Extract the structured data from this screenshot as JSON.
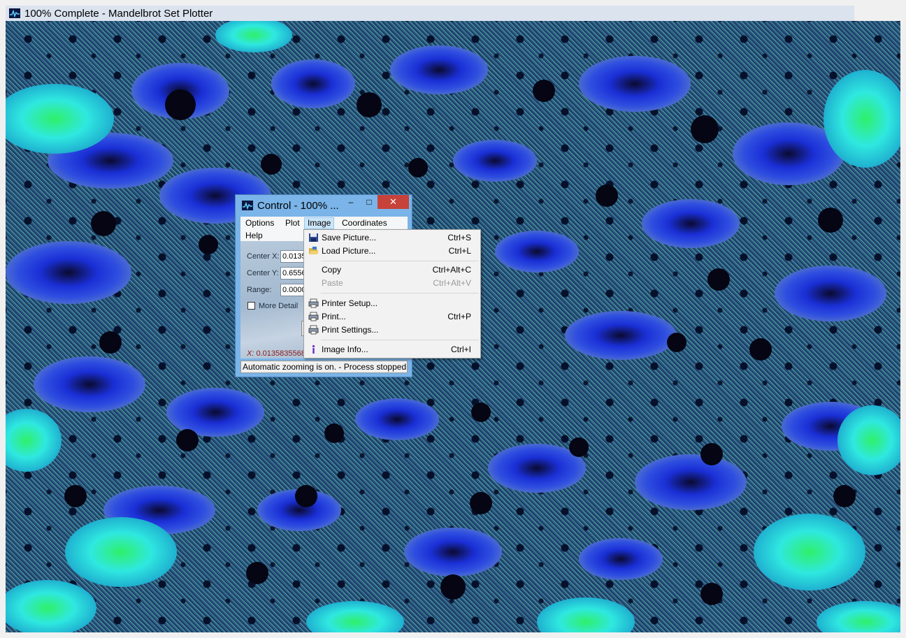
{
  "main_window": {
    "title": "100% Complete - Mandelbrot Set Plotter",
    "icon": "mandelbrot-app-icon"
  },
  "control_window": {
    "title": "Control - 100% ...",
    "caption_buttons": {
      "minimize": "–",
      "maximize": "□",
      "close": "✕"
    },
    "menu": {
      "options": "Options",
      "plot": "Plot",
      "image": "Image",
      "coordinates": "Coordinates",
      "help": "Help"
    },
    "fields": {
      "center_x_label": "Center X:",
      "center_x_value": "0.0135",
      "center_y_label": "Center Y:",
      "center_y_value": "0.6556",
      "range_label": "Range:",
      "range_value": "0.0000",
      "more_detail_label": "More Detail",
      "more_detail_checked": false
    },
    "coord_readout": {
      "axis": "X:",
      "value": "0.0135835568"
    },
    "status": "Automatic zooming is on. - Process stopped."
  },
  "image_menu": {
    "items": [
      {
        "label": "Save Picture...",
        "shortcut": "Ctrl+S",
        "icon": "floppy-disk-icon",
        "enabled": true
      },
      {
        "label": "Load Picture...",
        "shortcut": "Ctrl+L",
        "icon": "open-folder-icon",
        "enabled": true
      },
      {
        "label": "Copy",
        "shortcut": "Ctrl+Alt+C",
        "enabled": true
      },
      {
        "label": "Paste",
        "shortcut": "Ctrl+Alt+V",
        "enabled": false
      },
      {
        "label": "Printer Setup...",
        "shortcut": "",
        "icon": "printer-icon",
        "enabled": true
      },
      {
        "label": "Print...",
        "shortcut": "Ctrl+P",
        "icon": "printer-icon",
        "enabled": true
      },
      {
        "label": "Print Settings...",
        "shortcut": "",
        "icon": "printer-icon",
        "enabled": true
      },
      {
        "label": "Image Info...",
        "shortcut": "Ctrl+I",
        "icon": "info-icon",
        "enabled": true
      }
    ]
  },
  "colors": {
    "titlebar_active": "#7ab4e8",
    "close_button": "#c7423a",
    "menu_highlight": "#cce4f7",
    "fractal_blue": "#1a2fd6",
    "fractal_cyan": "#2fe8e0",
    "fractal_green": "#2ff06a"
  }
}
